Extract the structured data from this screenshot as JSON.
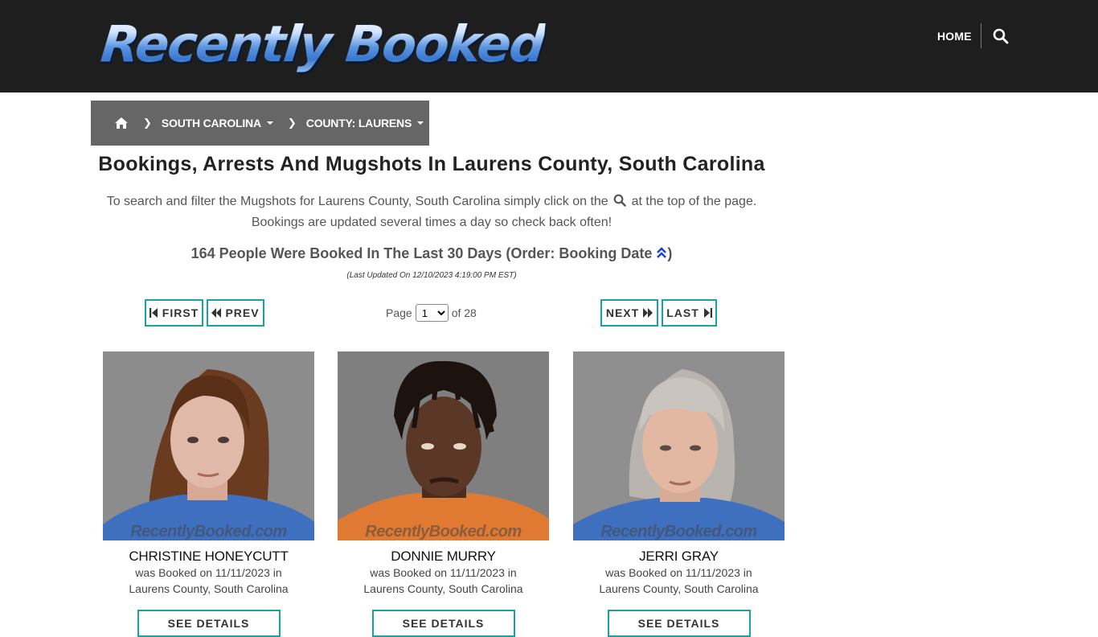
{
  "header": {
    "logo_text": "Recently Booked",
    "nav_home": "HOME",
    "search_icon": "search-icon"
  },
  "breadcrumb": {
    "home_icon": "home-icon",
    "state": "SOUTH CAROLINA",
    "county": "COUNTY: LAURENS"
  },
  "main": {
    "title": "Bookings, Arrests And Mugshots In Laurens County, South Carolina",
    "intro_part1": "To search and filter the Mugshots for Laurens County, South Carolina simply click on the",
    "intro_part2": "at the top of the page. Bookings are updated several times a day so check back often!",
    "count_text": "164 People Were Booked In The Last 30 Days (Order: Booking Date",
    "count_close": ")",
    "last_updated": "(Last Updated On 12/10/2023 4:19:00 PM EST)"
  },
  "pager": {
    "first": "FIRST",
    "prev": "PREV",
    "next": "NEXT",
    "last": "LAST",
    "page_label": "Page",
    "page_value": "1",
    "of_label": "of 28"
  },
  "bookings": [
    {
      "name": "CHRISTINE HONEYCUTT",
      "line1": "was Booked on 11/11/2023 in",
      "line2": "Laurens County, South Carolina",
      "button": "SEE DETAILS",
      "watermark": "RecentlyBooked.com"
    },
    {
      "name": "DONNIE MURRY",
      "line1": "was Booked on 11/11/2023 in",
      "line2": "Laurens County, South Carolina",
      "button": "SEE DETAILS",
      "watermark": "RecentlyBooked.com"
    },
    {
      "name": "JERRI GRAY",
      "line1": "was Booked on 11/11/2023 in",
      "line2": "Laurens County, South Carolina",
      "button": "SEE DETAILS",
      "watermark": "RecentlyBooked.com"
    }
  ],
  "colors": {
    "topbar": "#1e1e1e",
    "breadcrumb": "#666666",
    "accent_border": "#17a2a6",
    "sort_icon": "#1f3fd1"
  }
}
